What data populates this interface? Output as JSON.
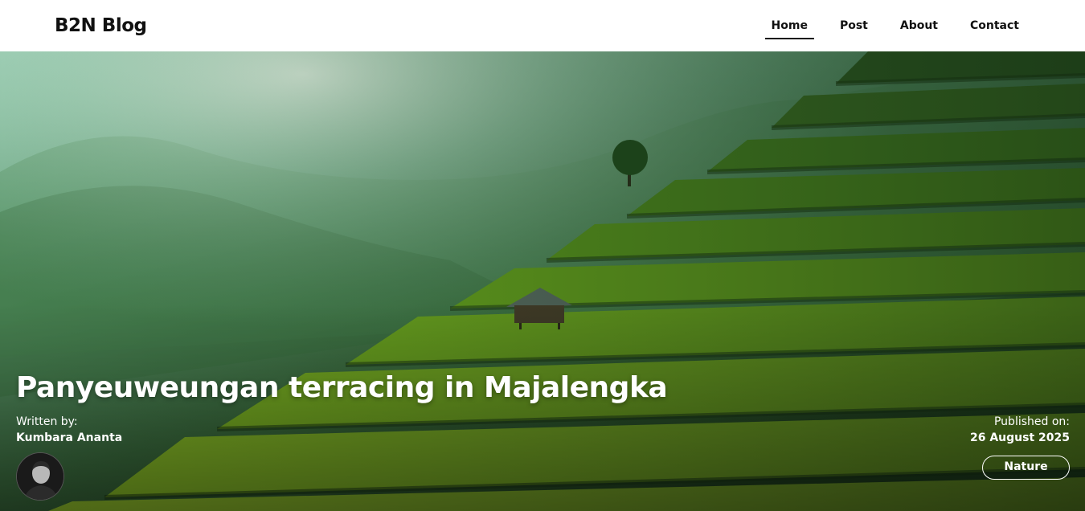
{
  "header": {
    "logo": "B2N Blog",
    "nav": [
      {
        "label": "Home",
        "active": true
      },
      {
        "label": "Post",
        "active": false
      },
      {
        "label": "About",
        "active": false
      },
      {
        "label": "Contact",
        "active": false
      }
    ]
  },
  "article": {
    "title": "Panyeuweungan terracing in Majalengka",
    "written_label": "Written by:",
    "author": "Kumbara Ananta",
    "published_label": "Published on:",
    "published_date": "26 August 2025",
    "category": "Nature"
  },
  "colors": {
    "header_bg": "#ffffff",
    "text_dark": "#111111",
    "overlay_text": "#ffffff",
    "terrace_green": "#6b9a1e",
    "mist": "#a7d3c0"
  }
}
